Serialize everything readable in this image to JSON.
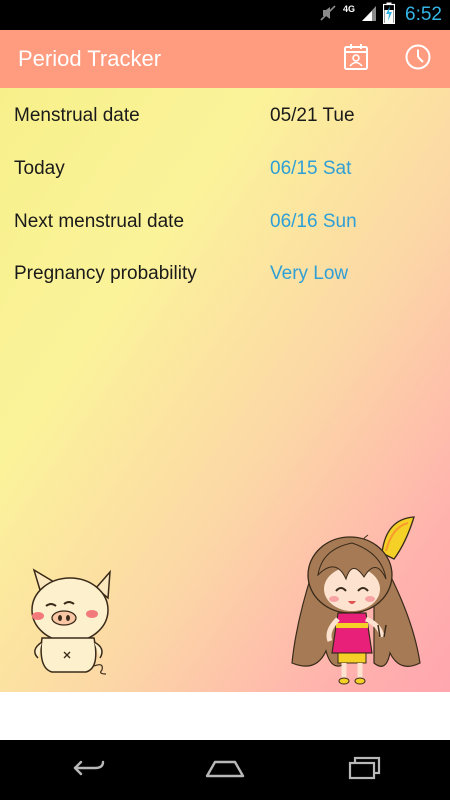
{
  "status_bar": {
    "time": "6:52",
    "network": "4G"
  },
  "action_bar": {
    "title": "Period Tracker",
    "icons": [
      "calendar-icon",
      "clock-icon"
    ]
  },
  "rows": [
    {
      "label": "Menstrual date",
      "value": "05/21 Tue",
      "value_color": "#1a1a1a"
    },
    {
      "label": "Today",
      "value": "06/15 Sat",
      "value_color": "#2f9fd6"
    },
    {
      "label": "Next menstrual date",
      "value": "06/16 Sun",
      "value_color": "#2f9fd6"
    },
    {
      "label": "Pregnancy probability",
      "value": "Very Low",
      "value_color": "#2f9fd6"
    }
  ],
  "colors": {
    "action_bar": "#ff9b7e",
    "accent_blue": "#2f9fd6",
    "status_time": "#33b5e5"
  },
  "illustrations": [
    "pig-illustration",
    "bunny-girl-illustration"
  ],
  "nav_bar": {
    "buttons": [
      "back-icon",
      "home-icon",
      "recents-icon"
    ]
  }
}
